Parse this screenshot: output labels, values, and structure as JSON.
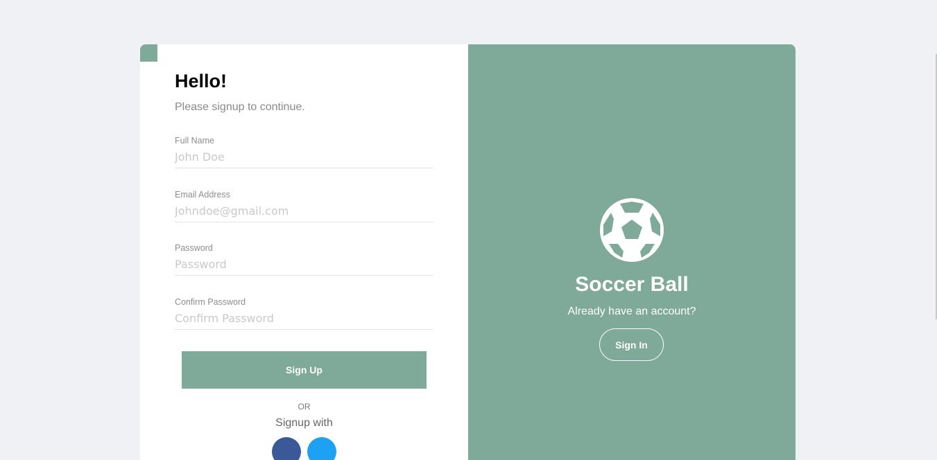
{
  "signup": {
    "title": "Hello!",
    "subtitle": "Please signup to continue.",
    "fields": [
      {
        "label": "Full Name",
        "placeholder": "John Doe",
        "value": ""
      },
      {
        "label": "Email Address",
        "placeholder": "Johndoe@gmail.com",
        "value": ""
      },
      {
        "label": "Password",
        "placeholder": "Password",
        "value": ""
      },
      {
        "label": "Confirm Password",
        "placeholder": "Confirm Password",
        "value": ""
      }
    ],
    "submit_label": "Sign Up",
    "or_text": "OR",
    "social_heading": "Signup with",
    "social": [
      {
        "icon": "facebook-icon",
        "color": "#3b5998"
      },
      {
        "icon": "twitter-icon",
        "color": "#1da1f2"
      }
    ]
  },
  "welcome": {
    "icon": "soccer-ball-icon",
    "title": "Soccer Ball",
    "prompt": "Already have an account?",
    "signin_label": "Sign In"
  },
  "theme": {
    "accent": "#7fa999",
    "background": "#f0f1f5"
  }
}
